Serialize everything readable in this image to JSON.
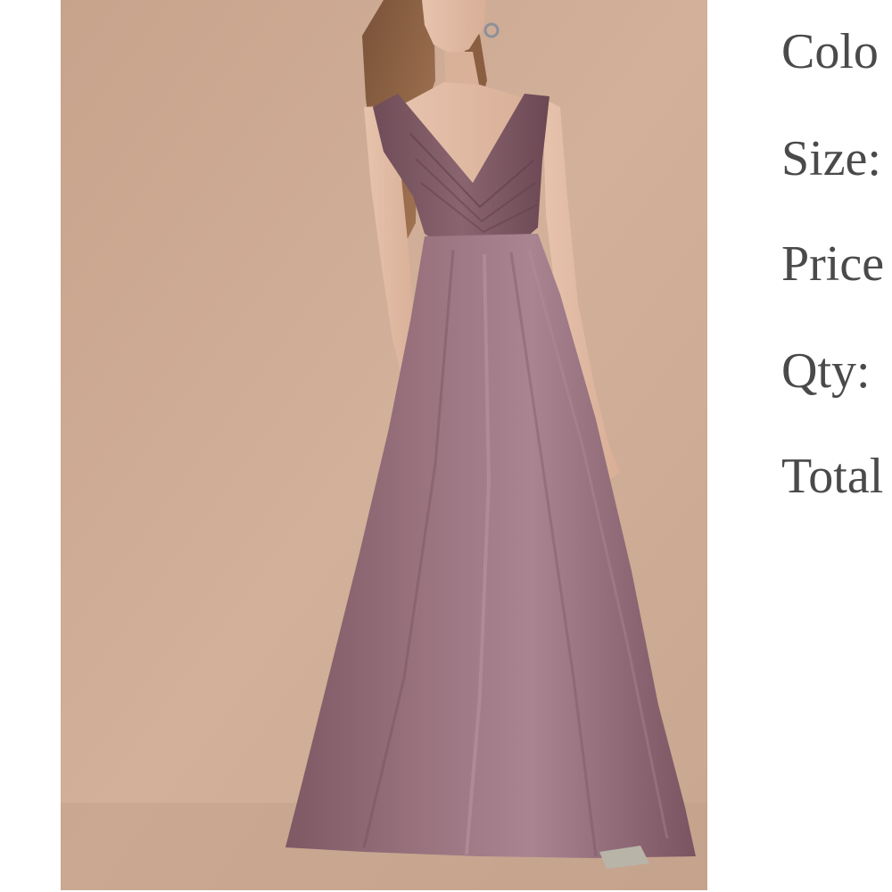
{
  "photo": {
    "subject": "model wearing a long sleeveless mauve chiffon gown",
    "background_color": "#cdab94",
    "dress_color": "#8c6670"
  },
  "details": {
    "color_label": "Colo",
    "size_label": "Size:",
    "price_label": "Price",
    "qty_label": "Qty:",
    "total_label": "Total"
  }
}
